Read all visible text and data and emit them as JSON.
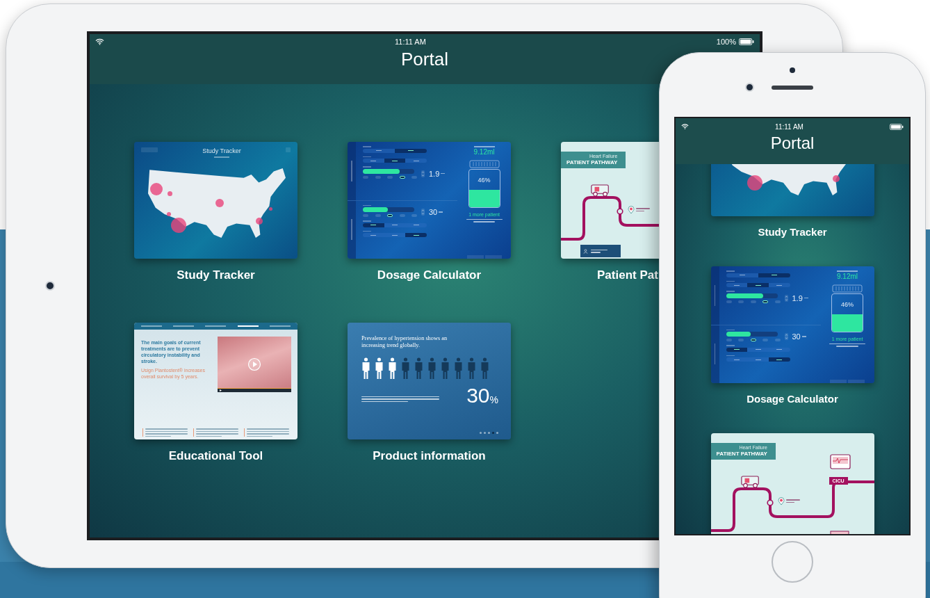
{
  "tablet": {
    "status_bar": {
      "time": "11:11 AM",
      "battery": "100%"
    },
    "title": "Portal",
    "tiles": [
      {
        "kind": "study_tracker",
        "label": "Study Tracker",
        "preview": {
          "title": "Study Tracker",
          "markers": [
            {
              "kind": "northwest"
            },
            {
              "kind": "west"
            },
            {
              "kind": "central"
            },
            {
              "kind": "mountain"
            },
            {
              "kind": "southwest"
            },
            {
              "kind": "northeast"
            },
            {
              "kind": "southeast"
            }
          ]
        }
      },
      {
        "kind": "dosage",
        "label": "Dosage Calculator",
        "preview": {
          "sections": [
            {
              "fields": [
                {
                  "kind": "segmented",
                  "options": [
                    {
                      "selected": false
                    },
                    {
                      "selected": true
                    }
                  ]
                },
                {
                  "kind": "segmented",
                  "options": [
                    {
                      "selected": false
                    },
                    {
                      "selected": true
                    },
                    {
                      "selected": false
                    }
                  ]
                },
                {
                  "kind": "slider",
                  "level": 0.72,
                  "value": "1.9",
                  "ticks": [
                    {
                      "selected": false
                    },
                    {
                      "selected": false
                    },
                    {
                      "selected": false
                    },
                    {
                      "selected": true
                    },
                    {
                      "selected": false
                    }
                  ]
                }
              ]
            },
            {
              "fields": [
                {
                  "kind": "slider",
                  "level": 0.48,
                  "value": "30",
                  "ticks": [
                    {
                      "selected": false
                    },
                    {
                      "selected": false
                    },
                    {
                      "selected": true
                    },
                    {
                      "selected": false
                    },
                    {
                      "selected": false
                    }
                  ]
                },
                {
                  "kind": "segmented",
                  "options": [
                    {
                      "selected": true
                    },
                    {
                      "selected": false
                    },
                    {
                      "selected": false
                    }
                  ]
                },
                {
                  "kind": "segmented",
                  "options": [
                    {
                      "selected": false
                    },
                    {
                      "selected": false
                    },
                    {
                      "selected": true
                    }
                  ]
                }
              ]
            }
          ],
          "suggested": "9.12ml",
          "vial": {
            "level": 0.46,
            "reading": "46%"
          },
          "result": "1 more patient"
        }
      },
      {
        "kind": "pathway",
        "label": "Patient Pat",
        "clipped": true,
        "preview": {
          "subtitle": "Heart Failure",
          "title": "PATIENT PATHWAY",
          "stops": [
            {
              "kind": "emergency"
            }
          ],
          "personnel_button": true
        }
      },
      {
        "kind": "education",
        "label": "Educational Tool",
        "preview": {
          "tabs": [
            {
              "selected": false
            },
            {
              "selected": false
            },
            {
              "selected": false
            },
            {
              "selected": true
            },
            {
              "selected": false
            }
          ],
          "heading": "The main goals of current treatments are to prevent circulatory instability and stroke.",
          "highlight": "Usign Plantostent® increases overall survival by 5 years."
        }
      },
      {
        "kind": "product",
        "label": "Product information",
        "preview": {
          "heading": "Prevalence of hypertension shows an increasing trend globally.",
          "people": [
            {
              "highlighted": true
            },
            {
              "highlighted": true
            },
            {
              "highlighted": true
            },
            {
              "highlighted": false
            },
            {
              "highlighted": false
            },
            {
              "highlighted": false
            },
            {
              "highlighted": false
            },
            {
              "highlighted": false
            },
            {
              "highlighted": false
            },
            {
              "highlighted": false
            }
          ],
          "figure": "30",
          "unit": "%",
          "dots": [
            {
              "selected": false
            },
            {
              "selected": false
            },
            {
              "selected": false
            },
            {
              "selected": true
            },
            {
              "selected": false
            }
          ]
        }
      }
    ]
  },
  "phone": {
    "status_bar": {
      "time": "11:11 AM"
    },
    "title": "Portal",
    "tiles": [
      {
        "kind": "study_tracker",
        "label": "Study Tracker",
        "preview": {
          "kind": "south"
        }
      },
      {
        "kind": "dosage",
        "label": "Dosage Calculator",
        "preview": {
          "sections": [
            {
              "fields": [
                {
                  "kind": "segmented",
                  "options": [
                    {
                      "selected": false
                    },
                    {
                      "selected": true
                    }
                  ]
                },
                {
                  "kind": "segmented",
                  "options": [
                    {
                      "selected": false
                    },
                    {
                      "selected": true
                    },
                    {
                      "selected": false
                    }
                  ]
                },
                {
                  "kind": "slider",
                  "level": 0.72,
                  "value": "1.9",
                  "ticks": [
                    {
                      "selected": false
                    },
                    {
                      "selected": false
                    },
                    {
                      "selected": false
                    },
                    {
                      "selected": true
                    },
                    {
                      "selected": false
                    }
                  ]
                }
              ]
            },
            {
              "fields": [
                {
                  "kind": "slider",
                  "level": 0.48,
                  "value": "30",
                  "ticks": [
                    {
                      "selected": false
                    },
                    {
                      "selected": false
                    },
                    {
                      "selected": true
                    },
                    {
                      "selected": false
                    },
                    {
                      "selected": false
                    }
                  ]
                },
                {
                  "kind": "segmented",
                  "options": [
                    {
                      "selected": true
                    },
                    {
                      "selected": false
                    },
                    {
                      "selected": false
                    }
                  ]
                },
                {
                  "kind": "segmented",
                  "options": [
                    {
                      "selected": false
                    },
                    {
                      "selected": false
                    },
                    {
                      "selected": true
                    }
                  ]
                }
              ]
            }
          ],
          "suggested": "9.12ml",
          "vial": {
            "level": 0.46,
            "reading": "46%"
          },
          "result": "1 more patient"
        }
      },
      {
        "kind": "pathway",
        "preview": {
          "subtitle": "Heart Failure",
          "title": "PATIENT PATHWAY",
          "stops": [
            {
              "kind": "emergency"
            },
            {
              "kind": "cicu",
              "label": "CICU"
            },
            {
              "kind": "bed"
            }
          ]
        }
      }
    ]
  }
}
